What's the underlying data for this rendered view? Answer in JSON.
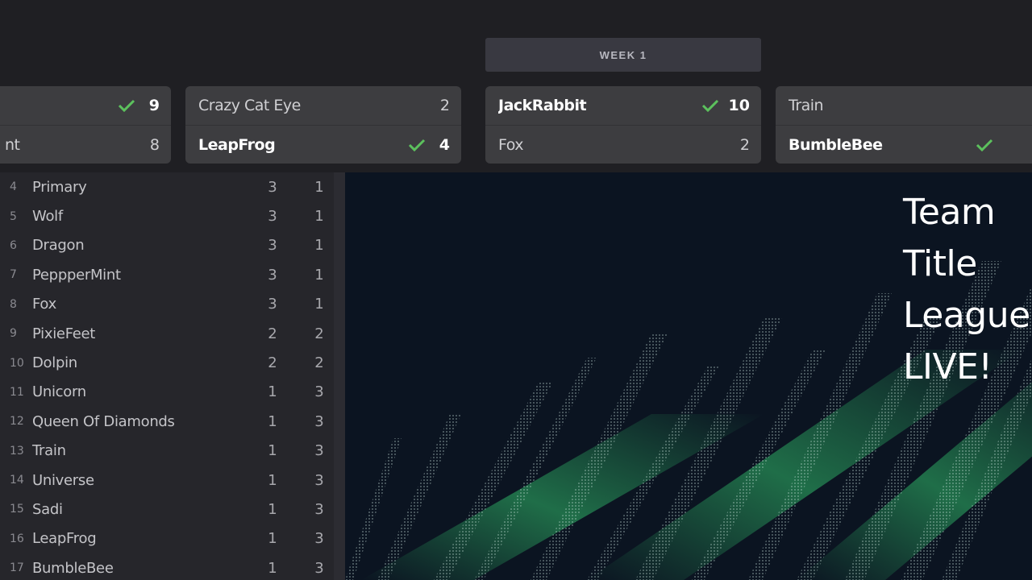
{
  "week_header": {
    "label": "WEEK 1"
  },
  "colors": {
    "check": "#5cc15d",
    "card_bg": "#3d3d40",
    "page_bg": "#1f1f23",
    "panel_bg": "#26262b",
    "promo_bg": "#0b1421",
    "accent_green": "#39e07a"
  },
  "matches": [
    {
      "teams": [
        {
          "name": "",
          "score": "9",
          "winner": true
        },
        {
          "name": "nt",
          "score": "8",
          "winner": false
        }
      ]
    },
    {
      "teams": [
        {
          "name": "Crazy Cat Eye",
          "score": "2",
          "winner": false
        },
        {
          "name": "LeapFrog",
          "score": "4",
          "winner": true
        }
      ]
    },
    {
      "teams": [
        {
          "name": "JackRabbit",
          "score": "10",
          "winner": true
        },
        {
          "name": "Fox",
          "score": "2",
          "winner": false
        }
      ]
    },
    {
      "teams": [
        {
          "name": "Train",
          "score": "",
          "winner": false
        },
        {
          "name": "BumbleBee",
          "score": "",
          "winner": true
        }
      ]
    }
  ],
  "standings": [
    {
      "rank": "4",
      "name": "Primary",
      "wins": "3",
      "losses": "1"
    },
    {
      "rank": "5",
      "name": "Wolf",
      "wins": "3",
      "losses": "1"
    },
    {
      "rank": "6",
      "name": "Dragon",
      "wins": "3",
      "losses": "1"
    },
    {
      "rank": "7",
      "name": "PeppperMint",
      "wins": "3",
      "losses": "1"
    },
    {
      "rank": "8",
      "name": "Fox",
      "wins": "3",
      "losses": "1"
    },
    {
      "rank": "9",
      "name": "PixieFeet",
      "wins": "2",
      "losses": "2"
    },
    {
      "rank": "10",
      "name": "Dolpin",
      "wins": "2",
      "losses": "2"
    },
    {
      "rank": "11",
      "name": "Unicorn",
      "wins": "1",
      "losses": "3"
    },
    {
      "rank": "12",
      "name": "Queen Of Diamonds",
      "wins": "1",
      "losses": "3"
    },
    {
      "rank": "13",
      "name": "Train",
      "wins": "1",
      "losses": "3"
    },
    {
      "rank": "14",
      "name": "Universe",
      "wins": "1",
      "losses": "3"
    },
    {
      "rank": "15",
      "name": "Sadi",
      "wins": "1",
      "losses": "3"
    },
    {
      "rank": "16",
      "name": "LeapFrog",
      "wins": "1",
      "losses": "3"
    },
    {
      "rank": "17",
      "name": "BumbleBee",
      "wins": "1",
      "losses": "3"
    }
  ],
  "promo": {
    "title_lines": [
      "Team",
      "Title",
      "League",
      "LIVE!"
    ]
  }
}
